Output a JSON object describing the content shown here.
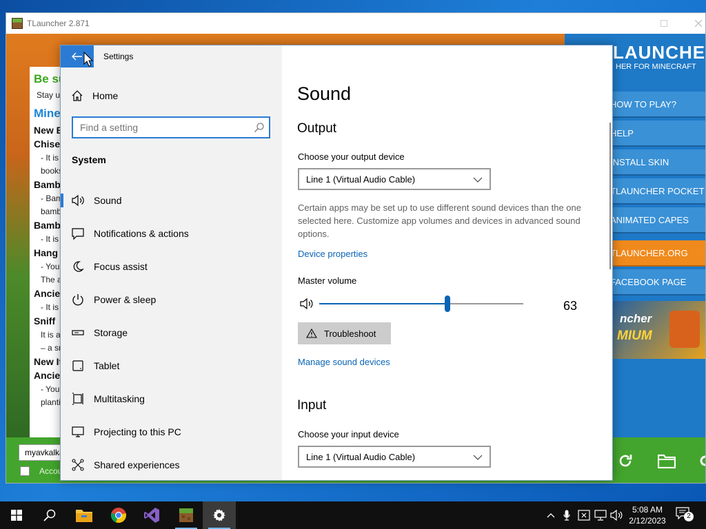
{
  "tlauncher": {
    "title": "TLauncher 2.871",
    "news": {
      "heading1": "Be su",
      "line1": "Stay u",
      "heading2": "Mine",
      "sub1": "New B",
      "items": [
        {
          "title": "Chise",
          "lines": [
            "- It is a",
            "books"
          ]
        },
        {
          "title": "Bamb",
          "lines": [
            "- Bam",
            "bamb"
          ]
        },
        {
          "title": "Bamb",
          "lines": [
            "- It is a"
          ]
        },
        {
          "title": "Hang",
          "lines": [
            "- You",
            "The a"
          ]
        },
        {
          "title": "Ancie",
          "lines": [
            "- It is a"
          ]
        },
        {
          "title": "Sniff",
          "lines": [
            "It is a",
            "– a sn"
          ]
        }
      ],
      "sub2": "New It",
      "items2": [
        {
          "title": "Ancie",
          "lines": [
            "- You",
            "planti"
          ]
        }
      ]
    },
    "logo_big": "LAUNCHER",
    "logo_small": "HER FOR MINECRAFT",
    "menu": [
      "HOW TO PLAY?",
      "HELP",
      "INSTALL SKIN",
      "TLAUNCHER POCKET",
      "ANIMATED CAPES",
      "TLAUNCHER.ORG",
      "FACEBOOK PAGE"
    ],
    "premium_line1": "ncher",
    "premium_line2": "MIUM",
    "username": "myavkalka",
    "account_label": "Accou"
  },
  "settings": {
    "window_title": "Settings",
    "home_label": "Home",
    "search_placeholder": "Find a setting",
    "section": "System",
    "nav": [
      {
        "label": "Sound",
        "icon": "speaker-icon",
        "active": true
      },
      {
        "label": "Notifications & actions",
        "icon": "notification-icon",
        "active": false
      },
      {
        "label": "Focus assist",
        "icon": "moon-icon",
        "active": false
      },
      {
        "label": "Power & sleep",
        "icon": "power-icon",
        "active": false
      },
      {
        "label": "Storage",
        "icon": "storage-icon",
        "active": false
      },
      {
        "label": "Tablet",
        "icon": "tablet-icon",
        "active": false
      },
      {
        "label": "Multitasking",
        "icon": "multitasking-icon",
        "active": false
      },
      {
        "label": "Projecting to this PC",
        "icon": "projector-icon",
        "active": false
      },
      {
        "label": "Shared experiences",
        "icon": "shared-icon",
        "active": false
      }
    ],
    "content": {
      "title": "Sound",
      "output_heading": "Output",
      "output_device_label": "Choose your output device",
      "output_device_value": "Line 1 (Virtual Audio Cable)",
      "output_desc": "Certain apps may be set up to use different sound devices than the one selected here. Customize app volumes and devices in advanced sound options.",
      "device_properties": "Device properties",
      "master_volume_label": "Master volume",
      "master_volume_value": "63",
      "master_volume_fraction": 0.63,
      "troubleshoot_label": "Troubleshoot",
      "manage_devices": "Manage sound devices",
      "input_heading": "Input",
      "input_device_label": "Choose your input device",
      "input_device_value": "Line 1 (Virtual Audio Cable)"
    }
  },
  "taskbar": {
    "apps": [
      "start-icon",
      "search-icon",
      "file-explorer-icon",
      "chrome-icon",
      "visual-studio-icon",
      "minecraft-icon",
      "settings-gear-icon"
    ],
    "time": "5:08 AM",
    "date": "2/12/2023",
    "notification_count": "2"
  },
  "colors": {
    "accent": "#0a64b4",
    "settings_accent": "#2b7bd4",
    "tl_green": "#43a52d",
    "tl_orange": "#f08a1c"
  }
}
